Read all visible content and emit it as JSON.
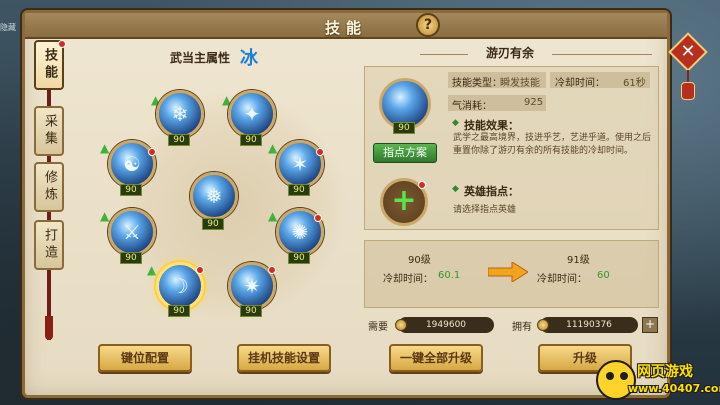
{
  "window": {
    "title": "技能",
    "help_label": "?",
    "close_label": "✕",
    "corner_text": "隐藏"
  },
  "side_tabs": [
    {
      "label": "技能",
      "active": true,
      "has_dot": true
    },
    {
      "label": "采集",
      "active": false,
      "has_dot": false
    },
    {
      "label": "修炼",
      "active": false,
      "has_dot": false
    },
    {
      "label": "打造",
      "active": false,
      "has_dot": false
    }
  ],
  "attribute": {
    "label": "武当主属性",
    "value": "冰"
  },
  "skills": [
    {
      "name": "skill-1",
      "level": "90",
      "glyph": "❄",
      "upgradable": true,
      "dot": false,
      "selected": false
    },
    {
      "name": "skill-2",
      "level": "90",
      "glyph": "✦",
      "upgradable": true,
      "dot": false,
      "selected": false
    },
    {
      "name": "skill-3",
      "level": "90",
      "glyph": "☯",
      "upgradable": true,
      "dot": true,
      "selected": false
    },
    {
      "name": "skill-4",
      "level": "90",
      "glyph": "✶",
      "upgradable": true,
      "dot": true,
      "selected": false
    },
    {
      "name": "skill-5",
      "level": "90",
      "glyph": "❅",
      "upgradable": false,
      "dot": false,
      "selected": false
    },
    {
      "name": "skill-6",
      "level": "90",
      "glyph": "⚔",
      "upgradable": true,
      "dot": false,
      "selected": false
    },
    {
      "name": "skill-7",
      "level": "90",
      "glyph": "✺",
      "upgradable": true,
      "dot": true,
      "selected": false
    },
    {
      "name": "skill-8",
      "level": "90",
      "glyph": "☽",
      "upgradable": true,
      "dot": true,
      "selected": true
    },
    {
      "name": "skill-9",
      "level": "90",
      "glyph": "✷",
      "upgradable": false,
      "dot": true,
      "selected": false
    }
  ],
  "detail": {
    "skill_name": "游刃有余",
    "icon_level": "90",
    "plan_button": "指点方案",
    "type_label": "技能类型：",
    "type_value": "瞬发技能",
    "cd_label": "冷却时间：",
    "cd_value": "61秒",
    "qi_label": "气消耗：",
    "qi_value": "925",
    "effect_title": "技能效果：",
    "effect_text": "武学之最高境界，技进乎艺，艺进乎道。使用之后重置你除了游刃有余的所有技能的冷却时间。",
    "hero_title": "英雄指点：",
    "hero_hint": "请选择指点英雄",
    "diamond": "◆"
  },
  "levels": {
    "current_level": "90级",
    "next_level": "91级",
    "cd_label": "冷却时间：",
    "current_cd": "60.1",
    "next_cd": "60"
  },
  "cost": {
    "need_label": "需要",
    "need_value": "1949600",
    "have_label": "拥有",
    "have_value": "11190376",
    "add_label": "+"
  },
  "buttons": {
    "keybind": "键位配置",
    "auto_skill": "挂机技能设置",
    "upgrade_all": "一键全部升级",
    "upgrade": "升级"
  },
  "watermark": {
    "title": "网页游戏",
    "url": "www.40407.com"
  },
  "colors": {
    "attribute_ice": "#1b7fd8",
    "upgrade_arrow": "#3fb23a",
    "level_ok": "#2f9a2a",
    "panel_bg": "#efe6d1"
  }
}
